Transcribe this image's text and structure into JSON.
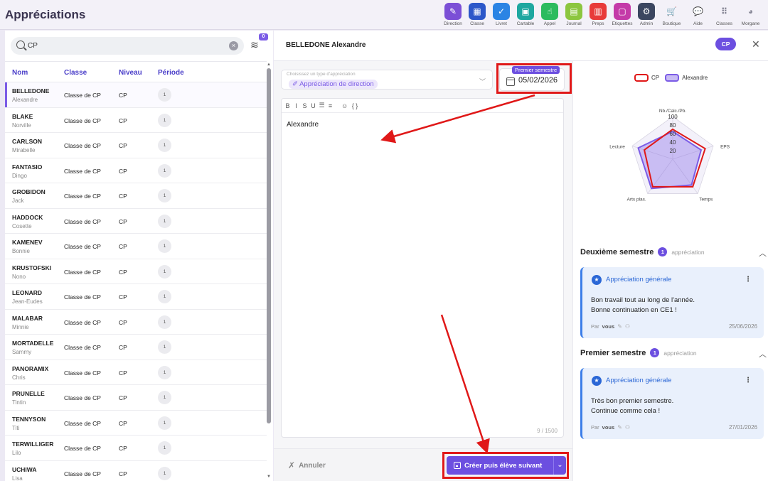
{
  "app": {
    "title": "Appréciations"
  },
  "nav": [
    {
      "label": "Direction",
      "color": "#7b4fd6",
      "glyph": "✎",
      "icon": "pen-icon"
    },
    {
      "label": "Classe",
      "color": "#2c57c9",
      "glyph": "▦",
      "icon": "classroom-icon"
    },
    {
      "label": "Livret",
      "color": "#2b84e4",
      "glyph": "✓",
      "icon": "check-icon"
    },
    {
      "label": "Cartable",
      "color": "#1ea7a0",
      "glyph": "▣",
      "icon": "briefcase-icon"
    },
    {
      "label": "Appel",
      "color": "#2dbb5f",
      "glyph": "☝",
      "icon": "hand-icon"
    },
    {
      "label": "Journal",
      "color": "#8cc63f",
      "glyph": "▤",
      "icon": "calendar-icon"
    },
    {
      "label": "Preps",
      "color": "#e83a3a",
      "glyph": "▥",
      "icon": "document-icon"
    },
    {
      "label": "Etiquettes",
      "color": "#c43aa8",
      "glyph": "▢",
      "icon": "label-icon"
    },
    {
      "label": "Admin",
      "color": "#3b4660",
      "glyph": "⚙",
      "icon": "gear-icon"
    },
    {
      "label": "Boutique",
      "color": "",
      "glyph": "🛒",
      "icon": "cart-icon"
    },
    {
      "label": "Aide",
      "color": "",
      "glyph": "💬",
      "icon": "chat-icon"
    },
    {
      "label": "Classes",
      "color": "",
      "glyph": "⠿",
      "icon": "grid-icon"
    },
    {
      "label": "Morgane",
      "color": "",
      "glyph": "◕",
      "icon": "avatar-icon"
    }
  ],
  "search": {
    "value": "CP",
    "placeholder": "",
    "badge": "0"
  },
  "table": {
    "headers": {
      "name": "Nom",
      "class": "Classe",
      "level": "Niveau",
      "period": "Période"
    },
    "rows": [
      {
        "last": "BELLEDONE",
        "first": "Alexandre",
        "class": "Classe de CP",
        "level": "CP",
        "period": "1"
      },
      {
        "last": "BLAKE",
        "first": "Norville",
        "class": "Classe de CP",
        "level": "CP",
        "period": "1"
      },
      {
        "last": "CARLSON",
        "first": "Mirabelle",
        "class": "Classe de CP",
        "level": "CP",
        "period": "1"
      },
      {
        "last": "FANTASIO",
        "first": "Dingo",
        "class": "Classe de CP",
        "level": "CP",
        "period": "1"
      },
      {
        "last": "GROBIDON",
        "first": "Jack",
        "class": "Classe de CP",
        "level": "CP",
        "period": "1"
      },
      {
        "last": "HADDOCK",
        "first": "Cosette",
        "class": "Classe de CP",
        "level": "CP",
        "period": "1"
      },
      {
        "last": "KAMENEV",
        "first": "Bonnie",
        "class": "Classe de CP",
        "level": "CP",
        "period": "1"
      },
      {
        "last": "KRUSTOFSKI",
        "first": "Nono",
        "class": "Classe de CP",
        "level": "CP",
        "period": "1"
      },
      {
        "last": "LEONARD",
        "first": "Jean-Eudes",
        "class": "Classe de CP",
        "level": "CP",
        "period": "1"
      },
      {
        "last": "MALABAR",
        "first": "Minnie",
        "class": "Classe de CP",
        "level": "CP",
        "period": "1"
      },
      {
        "last": "MORTADELLE",
        "first": "Sammy",
        "class": "Classe de CP",
        "level": "CP",
        "period": "1"
      },
      {
        "last": "PANORAMIX",
        "first": "Chris",
        "class": "Classe de CP",
        "level": "CP",
        "period": "1"
      },
      {
        "last": "PRUNELLE",
        "first": "Tintin",
        "class": "Classe de CP",
        "level": "CP",
        "period": "1"
      },
      {
        "last": "TENNYSON",
        "first": "Titi",
        "class": "Classe de CP",
        "level": "CP",
        "period": "1"
      },
      {
        "last": "TERWILLIGER",
        "first": "Lilo",
        "class": "Classe de CP",
        "level": "CP",
        "period": "1"
      },
      {
        "last": "UCHIWA",
        "first": "Lisa",
        "class": "Classe de CP",
        "level": "CP",
        "period": "1"
      }
    ]
  },
  "detail": {
    "student": "BELLEDONE Alexandre",
    "level_pill": "CP",
    "type_label": "Choisissez un type d'appréciation",
    "type_value": "Appréciation de direction",
    "period_tag": "Premier semestre",
    "date": "05/02/2026",
    "editor_text": "Alexandre",
    "char_count": "9 / 1500",
    "toolbar": [
      "B",
      "I",
      "S",
      "U",
      "☰",
      "≡",
      "☺",
      "{ }"
    ],
    "cancel_label": "Annuler",
    "save_label": "Créer puis élève suivant"
  },
  "radar": {
    "legend_cp": "CP",
    "legend_student": "Alexandre",
    "axes": [
      "Nb./Calc./Pb.",
      "EPS",
      "Temps",
      "Arts plas.",
      "Lecture"
    ],
    "ticks": [
      "20",
      "40",
      "60",
      "80",
      "100"
    ],
    "cp": [
      70,
      80,
      80,
      80,
      70
    ],
    "student": [
      65,
      70,
      75,
      85,
      85
    ],
    "colors": {
      "cp": "#e01818",
      "student": "#7b5ce6"
    }
  },
  "sections": [
    {
      "title": "Deuxième semestre",
      "count": "1",
      "sub": "appréciation",
      "card_title": "Appréciation générale",
      "lines": [
        "Bon travail tout au long de l'année.",
        "Bonne continuation en CE1 !"
      ],
      "by": "Par",
      "by_who": "vous",
      "date": "25/06/2026"
    },
    {
      "title": "Premier semestre",
      "count": "1",
      "sub": "appréciation",
      "card_title": "Appréciation générale",
      "lines": [
        "Très bon premier semestre.",
        "Continue comme cela !"
      ],
      "by": "Par",
      "by_who": "vous",
      "date": "27/01/2026"
    }
  ]
}
